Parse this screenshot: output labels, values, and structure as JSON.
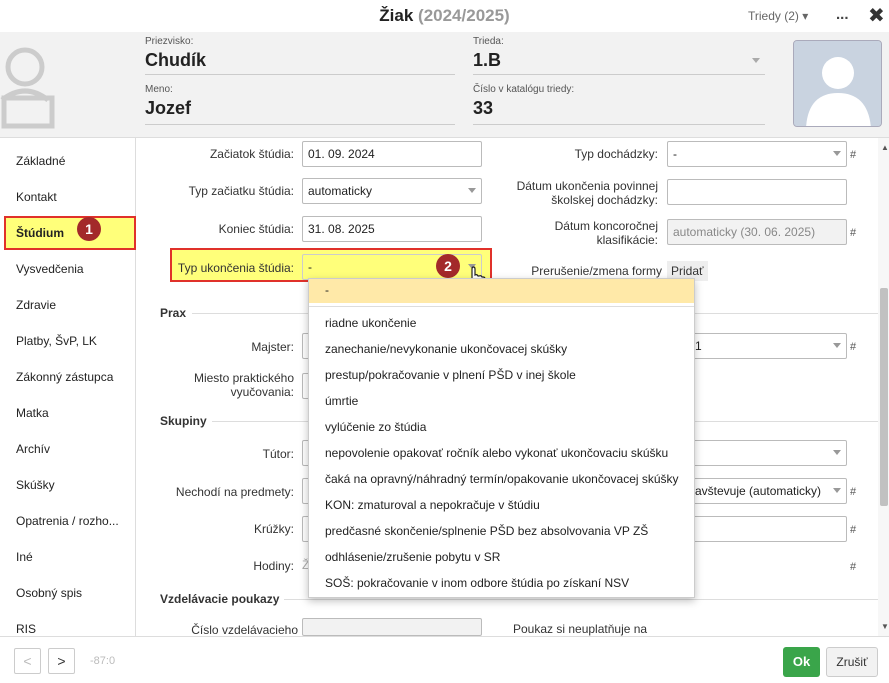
{
  "window": {
    "title": "Žiak",
    "year": "(2024/2025)",
    "triedy": "Triedy (2)",
    "more": "...",
    "close": "✖"
  },
  "header": {
    "priezvisko_label": "Priezvisko:",
    "priezvisko": "Chudík",
    "trieda_label": "Trieda:",
    "trieda": "1.B",
    "meno_label": "Meno:",
    "meno": "Jozef",
    "cislo_label": "Číslo v katalógu triedy:",
    "cislo": "33"
  },
  "sidebar": {
    "items": [
      "Základné",
      "Kontakt",
      "Štúdium",
      "Vysvedčenia",
      "Zdravie",
      "Platby, ŠvP, LK",
      "Zákonný zástupca",
      "Matka",
      "Archív",
      "Skúšky",
      "Opatrenia / rozho...",
      "Iné",
      "Osobný spis",
      "RIS"
    ],
    "selected_badge": "1"
  },
  "form": {
    "zaciatok_label": "Začiatok štúdia:",
    "zaciatok": "01. 09. 2024",
    "typ_zaciatku_label": "Typ začiatku štúdia:",
    "typ_zaciatku": "automaticky",
    "koniec_label": "Koniec štúdia:",
    "koniec": "31. 08. 2025",
    "typ_ukoncenia_label": "Typ ukončenia štúdia:",
    "typ_ukoncenia": "-",
    "typ_ukoncenia_badge": "2",
    "typ_dochadzky_label": "Typ dochádzky:",
    "typ_dochadzky": "-",
    "datum_ukoncenia_label_1": "Dátum ukončenia povinnej",
    "datum_ukoncenia_label_2": "školskej dochádzky:",
    "datum_konc_label_1": "Dátum koncoročnej",
    "datum_konc_label_2": "klasifikácie:",
    "datum_konc": "automaticky (30. 06. 2025)",
    "prerusenie_label": "Prerušenie/zmena formy",
    "pridat": "Pridať",
    "prax_title": "Prax",
    "majster_label": "Majster:",
    "majster_right": "1",
    "miesto_label_1": "Miesto praktického",
    "miesto_label_2": "vyučovania:",
    "skupiny_title": "Skupiny",
    "tutor_label": "Tútor:",
    "nechodi_label": "Nechodí na predmety:",
    "nechodi_right": "avštevuje (automaticky)",
    "kruzky_label": "Krúžky:",
    "hodiny_label": "Hodiny:",
    "hodiny_val": "Ž",
    "poukazy_title": "Vzdelávacie poukazy",
    "cislo_vzd_label": "Číslo vzdelávacieho",
    "poukaz_label": "Poukaz si neuplatňuje na",
    "hash": "#"
  },
  "dropdown": {
    "options": [
      "-",
      "riadne ukončenie",
      "zanechanie/nevykonanie ukončovacej skúšky",
      "prestup/pokračovanie v plnení PŠD v inej škole",
      "úmrtie",
      "vylúčenie zo štúdia",
      "nepovolenie opakovať ročník alebo vykonať ukončovaciu skúšku",
      "čaká na opravný/náhradný termín/opakovanie ukončovacej skúšky",
      "KON: zmaturoval a nepokračuje v štúdiu",
      "predčasné skončenie/splnenie PŠD bez absolvovania VP ZŠ",
      "odhlásenie/zrušenie pobytu v SR",
      "SOŠ: pokračovanie v inom odbore štúdia po získaní NSV"
    ]
  },
  "footer": {
    "prev": "<",
    "next": ">",
    "code": "-87:0",
    "ok": "Ok",
    "cancel": "Zrušiť"
  },
  "colors": {
    "highlight": "#ffff7a",
    "red_border": "#e0312a",
    "badge": "#a3292a",
    "ok_green": "#3aa54a"
  }
}
